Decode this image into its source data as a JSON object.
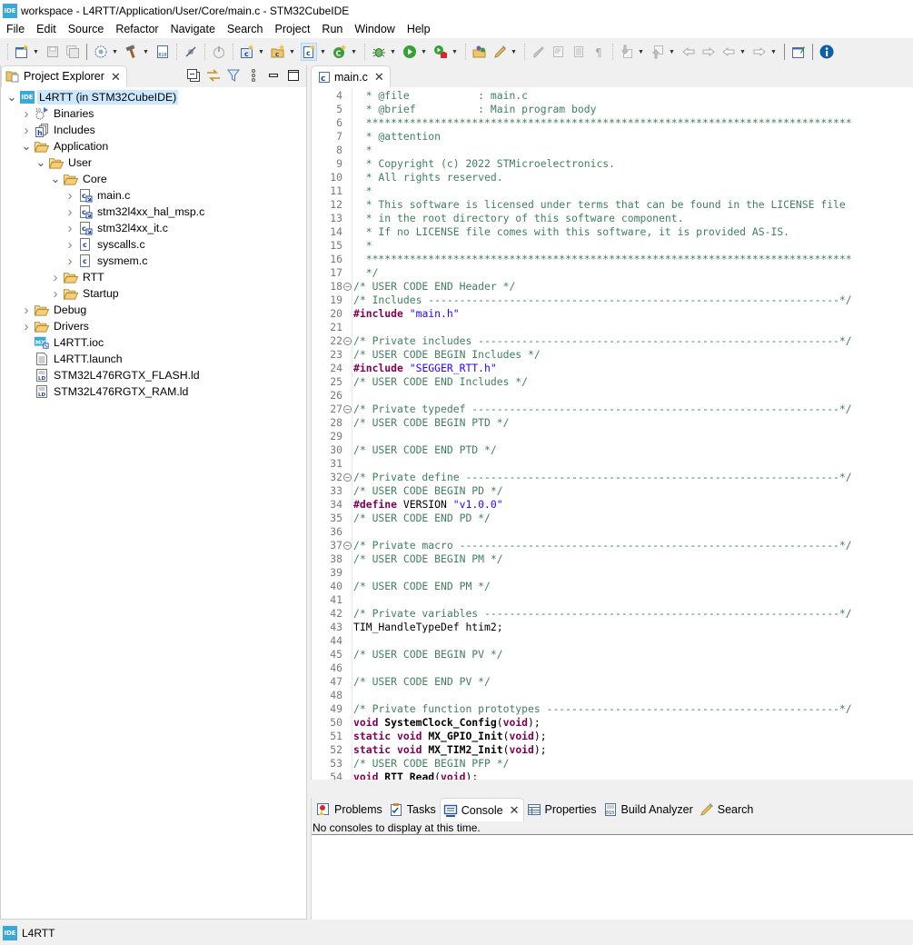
{
  "window": {
    "title": "workspace - L4RTT/Application/User/Core/main.c - STM32CubeIDE",
    "logo_text": "IDE"
  },
  "menu": [
    "File",
    "Edit",
    "Source",
    "Refactor",
    "Navigate",
    "Search",
    "Project",
    "Run",
    "Window",
    "Help"
  ],
  "toolbar": {
    "buttons": [
      "new",
      "save",
      "save-all",
      "build-config",
      "build",
      "build-analyzer",
      "skip-breakpoints",
      "terminate",
      "new-c-project",
      "new-cpp-project",
      "new-c-source-file",
      "new-class",
      "debug",
      "run",
      "external-tools",
      "open-element",
      "search",
      "toggle-mark-occurrences",
      "word-wrap",
      "block-selection",
      "show-whitespace",
      "next-annotation",
      "previous-annotation",
      "last-edit-location",
      "forward-edit",
      "back",
      "forward",
      "open-perspective",
      "information"
    ]
  },
  "explorer": {
    "tab_label": "Project Explorer",
    "tree": [
      {
        "label": "L4RTT (in STM32CubeIDE)",
        "icon": "ide-project-icon",
        "depth": 0,
        "twisty": "expanded",
        "selected": true
      },
      {
        "label": "Binaries",
        "icon": "binaries-icon",
        "depth": 1,
        "twisty": "collapsed"
      },
      {
        "label": "Includes",
        "icon": "includes-icon",
        "depth": 1,
        "twisty": "collapsed"
      },
      {
        "label": "Application",
        "icon": "folder-icon",
        "depth": 1,
        "twisty": "expanded"
      },
      {
        "label": "User",
        "icon": "folder-icon",
        "depth": 2,
        "twisty": "expanded"
      },
      {
        "label": "Core",
        "icon": "folder-icon",
        "depth": 3,
        "twisty": "expanded"
      },
      {
        "label": "main.c",
        "icon": "c-file-linked-icon",
        "depth": 4,
        "twisty": "collapsed"
      },
      {
        "label": "stm32l4xx_hal_msp.c",
        "icon": "c-file-linked-icon",
        "depth": 4,
        "twisty": "collapsed"
      },
      {
        "label": "stm32l4xx_it.c",
        "icon": "c-file-linked-icon",
        "depth": 4,
        "twisty": "collapsed"
      },
      {
        "label": "syscalls.c",
        "icon": "c-file-icon",
        "depth": 4,
        "twisty": "collapsed"
      },
      {
        "label": "sysmem.c",
        "icon": "c-file-icon",
        "depth": 4,
        "twisty": "collapsed"
      },
      {
        "label": "RTT",
        "icon": "folder-icon",
        "depth": 3,
        "twisty": "collapsed"
      },
      {
        "label": "Startup",
        "icon": "folder-icon",
        "depth": 3,
        "twisty": "collapsed"
      },
      {
        "label": "Debug",
        "icon": "folder-icon",
        "depth": 1,
        "twisty": "collapsed"
      },
      {
        "label": "Drivers",
        "icon": "folder-icon",
        "depth": 1,
        "twisty": "collapsed"
      },
      {
        "label": "L4RTT.ioc",
        "icon": "mx-file-icon",
        "depth": 1,
        "twisty": "none"
      },
      {
        "label": "L4RTT.launch",
        "icon": "text-file-icon",
        "depth": 1,
        "twisty": "none"
      },
      {
        "label": "STM32L476RGTX_FLASH.ld",
        "icon": "ld-file-icon",
        "depth": 1,
        "twisty": "none"
      },
      {
        "label": "STM32L476RGTX_RAM.ld",
        "icon": "ld-file-icon",
        "depth": 1,
        "twisty": "none"
      }
    ]
  },
  "editor": {
    "tab_label": "main.c",
    "lines": [
      {
        "n": 4,
        "fold": false,
        "parts": [
          [
            "cm",
            "  * @file           : main.c"
          ]
        ]
      },
      {
        "n": 5,
        "fold": false,
        "parts": [
          [
            "cm",
            "  * @brief          : Main program body"
          ]
        ]
      },
      {
        "n": 6,
        "fold": false,
        "parts": [
          [
            "cm",
            "  ******************************************************************************"
          ]
        ]
      },
      {
        "n": 7,
        "fold": false,
        "parts": [
          [
            "cm",
            "  * @attention"
          ]
        ]
      },
      {
        "n": 8,
        "fold": false,
        "parts": [
          [
            "cm",
            "  *"
          ]
        ]
      },
      {
        "n": 9,
        "fold": false,
        "parts": [
          [
            "cm",
            "  * Copyright (c) 2022 STMicroelectronics."
          ]
        ]
      },
      {
        "n": 10,
        "fold": false,
        "parts": [
          [
            "cm",
            "  * All rights reserved."
          ]
        ]
      },
      {
        "n": 11,
        "fold": false,
        "parts": [
          [
            "cm",
            "  *"
          ]
        ]
      },
      {
        "n": 12,
        "fold": false,
        "parts": [
          [
            "cm",
            "  * This software is licensed under terms that can be found in the LICENSE file"
          ]
        ]
      },
      {
        "n": 13,
        "fold": false,
        "parts": [
          [
            "cm",
            "  * in the root directory of this software component."
          ]
        ]
      },
      {
        "n": 14,
        "fold": false,
        "parts": [
          [
            "cm",
            "  * If no LICENSE file comes with this software, it is provided AS-IS."
          ]
        ]
      },
      {
        "n": 15,
        "fold": false,
        "parts": [
          [
            "cm",
            "  *"
          ]
        ]
      },
      {
        "n": 16,
        "fold": false,
        "parts": [
          [
            "cm",
            "  ******************************************************************************"
          ]
        ]
      },
      {
        "n": 17,
        "fold": false,
        "parts": [
          [
            "cm",
            "  */"
          ]
        ]
      },
      {
        "n": 18,
        "fold": true,
        "parts": [
          [
            "cm",
            "/* USER CODE END Header */"
          ]
        ]
      },
      {
        "n": 19,
        "fold": false,
        "parts": [
          [
            "cm",
            "/* Includes ------------------------------------------------------------------*/"
          ]
        ]
      },
      {
        "n": 20,
        "fold": false,
        "parts": [
          [
            "pp",
            "#include"
          ],
          [
            "plain",
            " "
          ],
          [
            "str",
            "\"main.h\""
          ]
        ]
      },
      {
        "n": 21,
        "fold": false,
        "parts": []
      },
      {
        "n": 22,
        "fold": true,
        "parts": [
          [
            "cm",
            "/* Private includes ----------------------------------------------------------*/"
          ]
        ]
      },
      {
        "n": 23,
        "fold": false,
        "parts": [
          [
            "cm",
            "/* USER CODE BEGIN Includes */"
          ]
        ]
      },
      {
        "n": 24,
        "fold": false,
        "parts": [
          [
            "pp",
            "#include"
          ],
          [
            "plain",
            " "
          ],
          [
            "str",
            "\"SEGGER_RTT.h\""
          ]
        ]
      },
      {
        "n": 25,
        "fold": false,
        "parts": [
          [
            "cm",
            "/* USER CODE END Includes */"
          ]
        ]
      },
      {
        "n": 26,
        "fold": false,
        "parts": []
      },
      {
        "n": 27,
        "fold": true,
        "parts": [
          [
            "cm",
            "/* Private typedef -----------------------------------------------------------*/"
          ]
        ]
      },
      {
        "n": 28,
        "fold": false,
        "parts": [
          [
            "cm",
            "/* USER CODE BEGIN PTD */"
          ]
        ]
      },
      {
        "n": 29,
        "fold": false,
        "parts": []
      },
      {
        "n": 30,
        "fold": false,
        "parts": [
          [
            "cm",
            "/* USER CODE END PTD */"
          ]
        ]
      },
      {
        "n": 31,
        "fold": false,
        "parts": []
      },
      {
        "n": 32,
        "fold": true,
        "parts": [
          [
            "cm",
            "/* Private define ------------------------------------------------------------*/"
          ]
        ]
      },
      {
        "n": 33,
        "fold": false,
        "parts": [
          [
            "cm",
            "/* USER CODE BEGIN PD */"
          ]
        ]
      },
      {
        "n": 34,
        "fold": false,
        "parts": [
          [
            "pp",
            "#define"
          ],
          [
            "plain",
            " VERSION "
          ],
          [
            "str",
            "\"v1.0.0\""
          ]
        ]
      },
      {
        "n": 35,
        "fold": false,
        "parts": [
          [
            "cm",
            "/* USER CODE END PD */"
          ]
        ]
      },
      {
        "n": 36,
        "fold": false,
        "parts": []
      },
      {
        "n": 37,
        "fold": true,
        "parts": [
          [
            "cm",
            "/* Private macro -------------------------------------------------------------*/"
          ]
        ]
      },
      {
        "n": 38,
        "fold": false,
        "parts": [
          [
            "cm",
            "/* USER CODE BEGIN PM */"
          ]
        ]
      },
      {
        "n": 39,
        "fold": false,
        "parts": []
      },
      {
        "n": 40,
        "fold": false,
        "parts": [
          [
            "cm",
            "/* USER CODE END PM */"
          ]
        ]
      },
      {
        "n": 41,
        "fold": false,
        "parts": []
      },
      {
        "n": 42,
        "fold": false,
        "parts": [
          [
            "cm",
            "/* Private variables ---------------------------------------------------------*/"
          ]
        ]
      },
      {
        "n": 43,
        "fold": false,
        "parts": [
          [
            "plain",
            "TIM_HandleTypeDef htim2;"
          ]
        ]
      },
      {
        "n": 44,
        "fold": false,
        "parts": []
      },
      {
        "n": 45,
        "fold": false,
        "parts": [
          [
            "cm",
            "/* USER CODE BEGIN PV */"
          ]
        ]
      },
      {
        "n": 46,
        "fold": false,
        "parts": []
      },
      {
        "n": 47,
        "fold": false,
        "parts": [
          [
            "cm",
            "/* USER CODE END PV */"
          ]
        ]
      },
      {
        "n": 48,
        "fold": false,
        "parts": []
      },
      {
        "n": 49,
        "fold": false,
        "parts": [
          [
            "cm",
            "/* Private function prototypes -----------------------------------------------*/"
          ]
        ]
      },
      {
        "n": 50,
        "fold": false,
        "parts": [
          [
            "kw",
            "void"
          ],
          [
            "plain",
            " "
          ],
          [
            "fn",
            "SystemClock_Config"
          ],
          [
            "plain",
            "("
          ],
          [
            "kw",
            "void"
          ],
          [
            "plain",
            ");"
          ]
        ]
      },
      {
        "n": 51,
        "fold": false,
        "parts": [
          [
            "kw",
            "static"
          ],
          [
            "plain",
            " "
          ],
          [
            "kw",
            "void"
          ],
          [
            "plain",
            " "
          ],
          [
            "fn",
            "MX_GPIO_Init"
          ],
          [
            "plain",
            "("
          ],
          [
            "kw",
            "void"
          ],
          [
            "plain",
            ");"
          ]
        ]
      },
      {
        "n": 52,
        "fold": false,
        "parts": [
          [
            "kw",
            "static"
          ],
          [
            "plain",
            " "
          ],
          [
            "kw",
            "void"
          ],
          [
            "plain",
            " "
          ],
          [
            "fn",
            "MX_TIM2_Init"
          ],
          [
            "plain",
            "("
          ],
          [
            "kw",
            "void"
          ],
          [
            "plain",
            ");"
          ]
        ]
      },
      {
        "n": 53,
        "fold": false,
        "parts": [
          [
            "cm",
            "/* USER CODE BEGIN PFP */"
          ]
        ]
      },
      {
        "n": 54,
        "fold": false,
        "parts": [
          [
            "kw",
            "void"
          ],
          [
            "plain",
            " "
          ],
          [
            "fn",
            "RTT_Read"
          ],
          [
            "plain",
            "("
          ],
          [
            "kw",
            "void"
          ],
          [
            "plain",
            ");"
          ]
        ]
      }
    ],
    "hscroll_left": "<"
  },
  "console": {
    "tabs": [
      {
        "label": "Problems",
        "icon": "problems-icon",
        "active": false
      },
      {
        "label": "Tasks",
        "icon": "tasks-icon",
        "active": false
      },
      {
        "label": "Console",
        "icon": "console-icon",
        "active": true
      },
      {
        "label": "Properties",
        "icon": "properties-icon",
        "active": false
      },
      {
        "label": "Build Analyzer",
        "icon": "build-analyzer-icon",
        "active": false
      },
      {
        "label": "Search",
        "icon": "search-icon",
        "active": false
      }
    ],
    "message": "No consoles to display at this time."
  },
  "status": {
    "logo_text": "IDE",
    "text": "L4RTT"
  },
  "colors": {
    "ide_blue": "#39a9dc",
    "selection": "#cce8ff",
    "comment": "#3f7f5f",
    "keyword": "#7f0055",
    "string": "#2a00ff",
    "folder": "#e8b04a"
  }
}
